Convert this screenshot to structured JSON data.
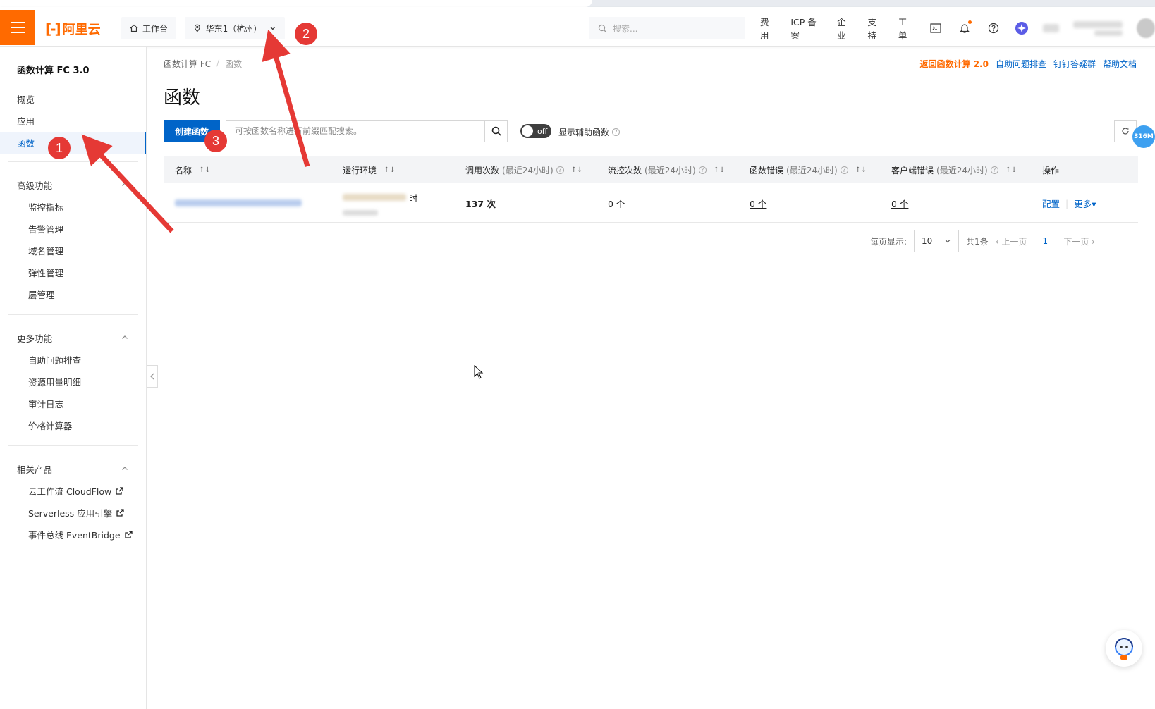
{
  "topbar": {
    "brand": "阿里云",
    "workbench": "工作台",
    "region": "华东1（杭州）",
    "search_placeholder": "搜索...",
    "nav": [
      "费用",
      "ICP 备案",
      "企业",
      "支持",
      "工单"
    ]
  },
  "sidebar": {
    "title": "函数计算 FC 3.0",
    "main_items": [
      "概览",
      "应用",
      "函数"
    ],
    "active_item": "函数",
    "advanced": {
      "label": "高级功能",
      "items": [
        "监控指标",
        "告警管理",
        "域名管理",
        "弹性管理",
        "层管理"
      ]
    },
    "more": {
      "label": "更多功能",
      "items": [
        "自助问题排查",
        "资源用量明细",
        "审计日志",
        "价格计算器"
      ]
    },
    "related": {
      "label": "相关产品",
      "items": [
        "云工作流 CloudFlow",
        "Serverless 应用引擎",
        "事件总线 EventBridge"
      ]
    }
  },
  "breadcrumb": [
    "函数计算 FC",
    "函数"
  ],
  "top_links": {
    "back": "返回函数计算 2.0",
    "troubleshoot": "自助问题排查",
    "dingtalk": "钉钉答疑群",
    "docs": "帮助文档"
  },
  "page_title": "函数",
  "toolbar": {
    "create_label": "创建函数",
    "search_placeholder": "可按函数名称进行前缀匹配搜索。",
    "toggle_state": "off",
    "toggle_label": "显示辅助函数"
  },
  "table": {
    "headers": [
      {
        "main": "名称",
        "sub": ""
      },
      {
        "main": "运行环境",
        "sub": ""
      },
      {
        "main": "调用次数",
        "sub": "(最近24小时)"
      },
      {
        "main": "流控次数",
        "sub": "(最近24小时)"
      },
      {
        "main": "函数错误",
        "sub": "(最近24小时)"
      },
      {
        "main": "客户端错误",
        "sub": "(最近24小时)"
      },
      {
        "main": "操作",
        "sub": ""
      }
    ],
    "row": {
      "runtime_suffix": "时",
      "invocations": "137 次",
      "throttles": "0 个",
      "func_errors": "0 个",
      "client_errors": "0 个",
      "action_config": "配置",
      "action_more": "更多"
    }
  },
  "pagination": {
    "per_page_label": "每页显示:",
    "per_page": "10",
    "total": "共1条",
    "prev": "上一页",
    "current": "1",
    "next": "下一页"
  },
  "mem_badge": "316M",
  "annotations": [
    "1",
    "2",
    "3"
  ],
  "colors": {
    "brand_orange": "#ff6a00",
    "primary_blue": "#0064c8",
    "annotation_red": "#e53935"
  }
}
